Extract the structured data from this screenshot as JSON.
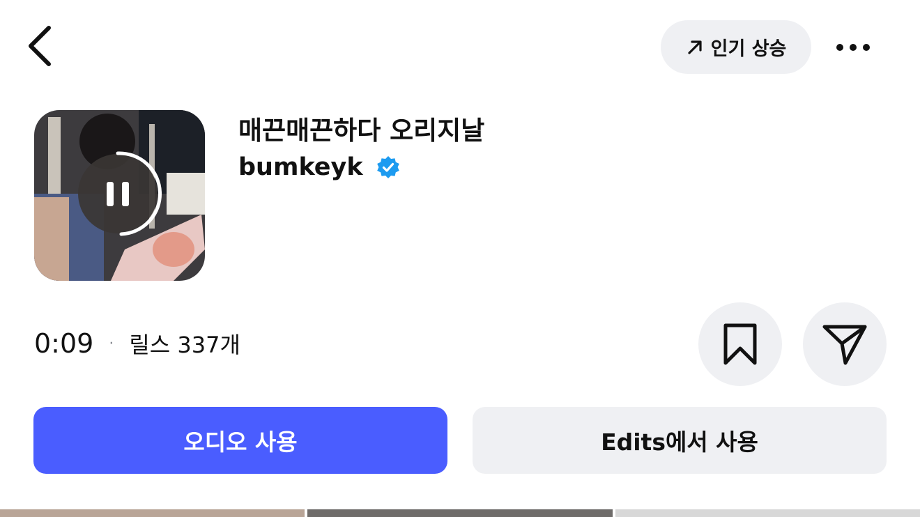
{
  "header": {
    "back_icon": "chevron-left-icon",
    "trending_icon": "arrow-up-right-icon",
    "trending_label": "인기 상승",
    "more_icon": "more-horizontal-icon"
  },
  "audio": {
    "title": "매끈매끈하다 오리지날",
    "artist": "bumkeyk",
    "verified_icon": "verified-badge-icon",
    "playback_icon": "pause-icon",
    "duration": "0:09",
    "separator": "·",
    "reels_count": "릴스 337개"
  },
  "actions": {
    "save_icon": "bookmark-icon",
    "share_icon": "send-icon",
    "use_audio_label": "오디오 사용",
    "use_in_edits_label": "Edits에서 사용"
  },
  "colors": {
    "accent": "#4a5dff",
    "pill_bg": "#eff0f3",
    "verified": "#1d9bf0",
    "text": "#111111"
  }
}
